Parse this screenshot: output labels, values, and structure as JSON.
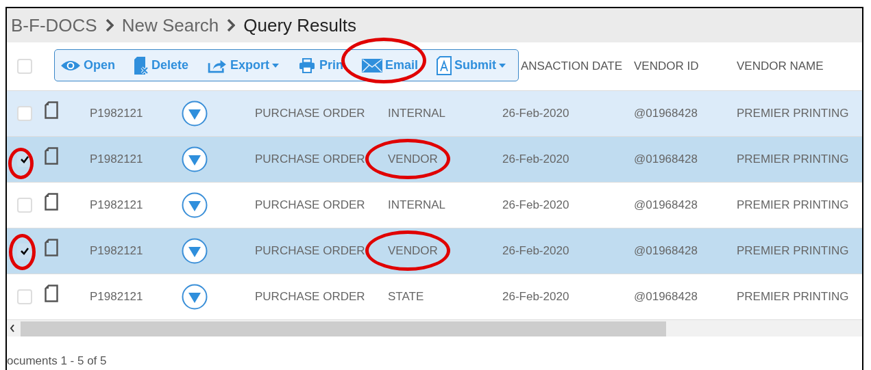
{
  "breadcrumb": [
    {
      "label": "B-F-DOCS",
      "current": false
    },
    {
      "label": "New Search",
      "current": false
    },
    {
      "label": "Query Results",
      "current": true
    }
  ],
  "toolbar": [
    {
      "label": "Open",
      "kind": "open",
      "has_menu": false
    },
    {
      "label": "Delete",
      "kind": "delete",
      "has_menu": false
    },
    {
      "label": "Export",
      "kind": "export",
      "has_menu": true
    },
    {
      "label": "Prin",
      "kind": "print",
      "has_menu": false
    },
    {
      "label": "Email",
      "kind": "email",
      "has_menu": false
    },
    {
      "label": "Submit",
      "kind": "submit",
      "has_menu": true
    }
  ],
  "table": {
    "select_all_checked": false,
    "columns": [
      "ANSACTION DATE",
      "VENDOR ID",
      "VENDOR NAME"
    ],
    "rows": [
      {
        "selected": false,
        "hovered": true,
        "id": "P1982121",
        "type": "PURCHASE ORDER",
        "category": "INTERNAL",
        "date": "26-Feb-2020",
        "vendor_id": "@01968428",
        "vendor_name": "PREMIER PRINTING"
      },
      {
        "selected": true,
        "hovered": false,
        "id": "P1982121",
        "type": "PURCHASE ORDER",
        "category": "VENDOR",
        "date": "26-Feb-2020",
        "vendor_id": "@01968428",
        "vendor_name": "PREMIER PRINTING"
      },
      {
        "selected": false,
        "hovered": false,
        "id": "P1982121",
        "type": "PURCHASE ORDER",
        "category": "INTERNAL",
        "date": "26-Feb-2020",
        "vendor_id": "@01968428",
        "vendor_name": "PREMIER PRINTING"
      },
      {
        "selected": true,
        "hovered": false,
        "id": "P1982121",
        "type": "PURCHASE ORDER",
        "category": "VENDOR",
        "date": "26-Feb-2020",
        "vendor_id": "@01968428",
        "vendor_name": "PREMIER PRINTING"
      },
      {
        "selected": false,
        "hovered": false,
        "id": "P1982121",
        "type": "PURCHASE ORDER",
        "category": "STATE",
        "date": "26-Feb-2020",
        "vendor_id": "@01968428",
        "vendor_name": "PREMIER PRINTING"
      }
    ]
  },
  "footer": "ocuments 1 - 5 of 5"
}
